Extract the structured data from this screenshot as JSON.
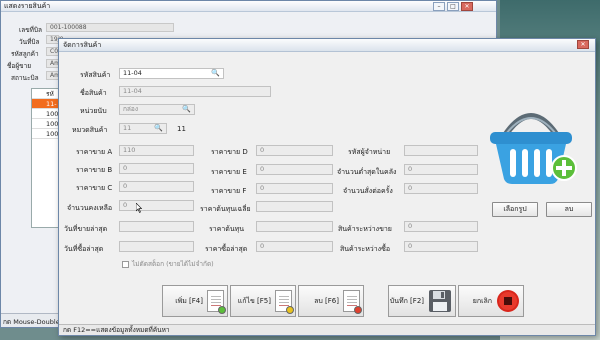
{
  "bg_window": {
    "title": "แสดงรายสินค้า",
    "rows": [
      {
        "label": "เลขที่บิล",
        "value": "001-100088"
      },
      {
        "label": "วันที่บิล",
        "value": "19/0"
      },
      {
        "label": "รหัสลูกค้า",
        "value": "C00"
      },
      {
        "label": "ชื่อผู้ขาย",
        "value": "Am"
      },
      {
        "label": "สถานะบิล",
        "value": "Am"
      }
    ],
    "grid_header": "รหั",
    "grid_rows": [
      "11-",
      "100",
      "100",
      "100"
    ],
    "status": "กด Mouse-Double"
  },
  "dialog": {
    "title": "จัดการสินค้า",
    "product_code": {
      "label": "รหัสสินค้า",
      "value": "11-04"
    },
    "product_name": {
      "label": "ชื่อสินค้า",
      "value": "11-04"
    },
    "unit": {
      "label": "หน่วยนับ",
      "value": "กล่อง"
    },
    "category": {
      "label": "หมวดสินค้า",
      "value": "11",
      "extra": "11"
    },
    "price_a": {
      "label": "ราคาขาย A",
      "value": "110"
    },
    "price_b": {
      "label": "ราคาขาย B",
      "value": "0"
    },
    "price_c": {
      "label": "ราคาขาย C",
      "value": "0"
    },
    "price_d": {
      "label": "ราคาขาย D",
      "value": "0"
    },
    "price_e": {
      "label": "ราคาขาย E",
      "value": "0"
    },
    "price_f": {
      "label": "ราคาขาย F",
      "value": "0"
    },
    "supplier": {
      "label": "รหัสผู้จำหน่าย",
      "value": ""
    },
    "min_qty": {
      "label": "จำนวนต่ำสุดในคลัง",
      "value": "0"
    },
    "order_qty": {
      "label": "จำนวนสั่งต่อครั้ง",
      "value": "0"
    },
    "stock_qty": {
      "label": "จำนวนคงเหลือ",
      "value": "0"
    },
    "avg_cost": {
      "label": "ราคาต้นทุนเฉลี่ย",
      "value": ""
    },
    "last_sale_date": {
      "label": "วันที่ขายล่าสุด",
      "value": ""
    },
    "cost_price": {
      "label": "ราคาต้นทุน",
      "value": ""
    },
    "pending_sale": {
      "label": "สินค้าระหว่างขาย",
      "value": "0"
    },
    "last_buy_date": {
      "label": "วันที่ซื้อล่าสุด",
      "value": ""
    },
    "last_buy_price": {
      "label": "ราคาซื้อล่าสุด",
      "value": "0"
    },
    "pending_buy": {
      "label": "สินค้าระหว่างซื้อ",
      "value": "0"
    },
    "no_stock_cut": "ไม่ตัดสต็อก (ขายได้ไม่จำกัด)",
    "choose_image": "เลือกรูป",
    "delete_image": "ลบ",
    "btn_add": "เพิ่ม [F4]",
    "btn_edit": "แก้ไข [F5]",
    "btn_delete": "ลบ [F6]",
    "btn_save": "บันทึก [F2]",
    "btn_cancel": "ยกเลิก",
    "status": "กด F12==แสดงข้อมูลทั้งหมดที่ค้นหา"
  }
}
